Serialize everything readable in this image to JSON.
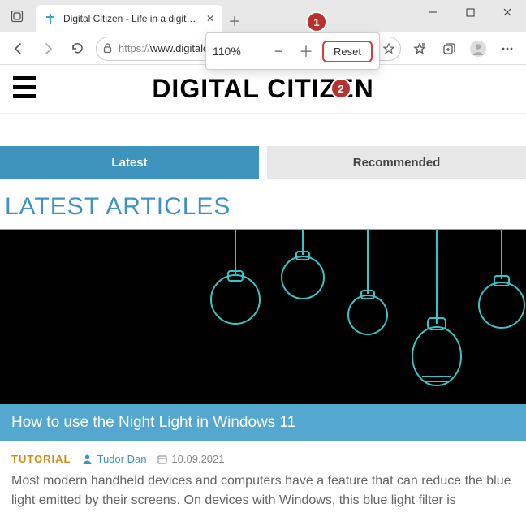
{
  "browser": {
    "tab_title": "Digital Citizen - Life in a digital w",
    "url_prefix": "https://",
    "url_host": "www.digitalcitizen.life"
  },
  "zoom": {
    "percent": "110%",
    "reset_label": "Reset"
  },
  "annotations": {
    "one": "1",
    "two": "2"
  },
  "site": {
    "title": "DIGITAL CITIZEN"
  },
  "tabs": {
    "latest": "Latest",
    "recommended": "Recommended"
  },
  "section_heading": "LATEST ARTICLES",
  "article": {
    "title": "How to use the Night Light in Windows 11",
    "category": "TUTORIAL",
    "author": "Tudor Dan",
    "date": "10.09.2021",
    "excerpt": "Most modern handheld devices and computers have a feature that can reduce the blue light emitted by their screens. On devices with Windows, this blue light filter is"
  }
}
